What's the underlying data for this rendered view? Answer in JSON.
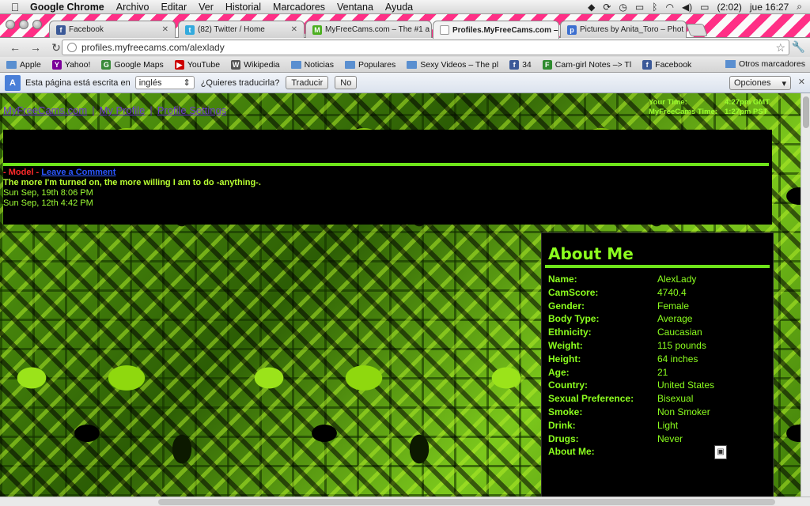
{
  "menubar": {
    "app": "Google Chrome",
    "items": [
      "Archivo",
      "Editar",
      "Ver",
      "Historial",
      "Marcadores",
      "Ventana",
      "Ayuda"
    ],
    "battery": "(2:02)",
    "clock": "jue 16:27"
  },
  "tabs": [
    {
      "title": "Facebook",
      "color": "#3b5998",
      "glyph": "f"
    },
    {
      "title": "(82) Twitter / Home",
      "color": "#33aadd",
      "glyph": "t"
    },
    {
      "title": "MyFreeCams.com – The #1 a",
      "color": "#4caf20",
      "glyph": "M"
    },
    {
      "title": "Profiles.MyFreeCams.com – A",
      "color": "#ffffff",
      "glyph": ""
    },
    {
      "title": "Pictures by Anita_Toro – Phot",
      "color": "#3c6fd0",
      "glyph": "p"
    }
  ],
  "address": {
    "url": "profiles.myfreecams.com/alexlady"
  },
  "bookmarks": {
    "items": [
      {
        "label": "Apple",
        "type": "folder"
      },
      {
        "label": "Yahoo!",
        "type": "site",
        "color": "#7b0099",
        "glyph": "Y"
      },
      {
        "label": "Google Maps",
        "type": "site",
        "color": "#3a8a3a",
        "glyph": "G"
      },
      {
        "label": "YouTube",
        "type": "site",
        "color": "#cc0000",
        "glyph": "▶"
      },
      {
        "label": "Wikipedia",
        "type": "site",
        "color": "#555555",
        "glyph": "W"
      },
      {
        "label": "Noticias",
        "type": "folder"
      },
      {
        "label": "Populares",
        "type": "folder"
      },
      {
        "label": "Sexy Videos – The pl",
        "type": "folder"
      },
      {
        "label": "34",
        "type": "site",
        "color": "#3b5998",
        "glyph": "f"
      },
      {
        "label": "Cam-girl Notes –> Tl",
        "type": "site",
        "color": "#2e8b2e",
        "glyph": "F"
      },
      {
        "label": "Facebook",
        "type": "site",
        "color": "#3b5998",
        "glyph": "f"
      }
    ],
    "more": "»",
    "other": "Otros marcadores"
  },
  "translate": {
    "text": "Esta página está escrita en",
    "language": "inglés",
    "question": "¿Quieres traducirla?",
    "translate_btn": "Traducir",
    "no_btn": "No",
    "options_btn": "Opciones"
  },
  "site_nav": {
    "home": "MyFreeCams.com",
    "sep1": "|",
    "my_profile": "My Profile",
    "sep2": "|",
    "profile_settings": "Profile Settings"
  },
  "time_box": {
    "your_time_label": "Your Time:",
    "your_time_value": "4:27pm GMT",
    "mfc_time_label": "MyFreeCams Time:",
    "mfc_time_value": "1:27pm PST"
  },
  "comments": {
    "model_tag": "- Model -",
    "leave_link": "Leave a Comment",
    "quote": "The more I'm turned on, the more willing I am to do -anything-.",
    "dates": [
      "Sun Sep, 19th 8:06 PM",
      "Sun Sep, 12th 4:42 PM"
    ]
  },
  "about": {
    "title": "About Me",
    "rows": [
      {
        "k": "Name:",
        "v": "AlexLady"
      },
      {
        "k": "CamScore:",
        "v": "4740.4"
      },
      {
        "k": "Gender:",
        "v": "Female"
      },
      {
        "k": "Body Type:",
        "v": "Average"
      },
      {
        "k": "Ethnicity:",
        "v": "Caucasian"
      },
      {
        "k": "Weight:",
        "v": "115 pounds"
      },
      {
        "k": "Height:",
        "v": "64 inches"
      },
      {
        "k": "Age:",
        "v": "21"
      },
      {
        "k": "Country:",
        "v": "United States"
      },
      {
        "k": "Sexual Preference:",
        "v": "Bisexual"
      },
      {
        "k": "Smoke:",
        "v": "Non Smoker"
      },
      {
        "k": "Drink:",
        "v": "Light"
      },
      {
        "k": "Drugs:",
        "v": "Never"
      },
      {
        "k": "About Me:",
        "v": ""
      }
    ]
  }
}
